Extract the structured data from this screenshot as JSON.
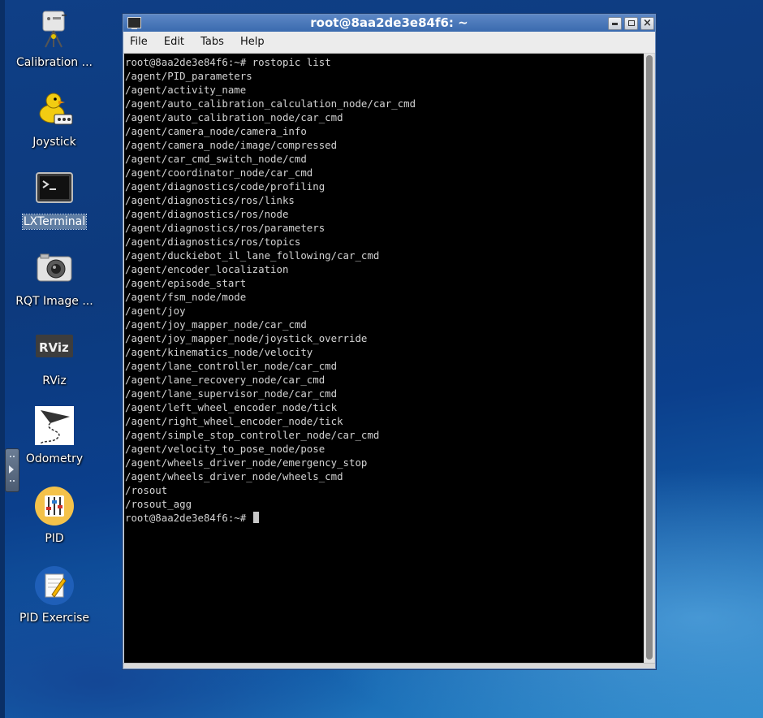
{
  "desktop": {
    "icons": [
      {
        "label": "Calibration ...",
        "icon": "calibration-icon"
      },
      {
        "label": "Joystick",
        "icon": "duck-joystick-icon"
      },
      {
        "label": "LXTerminal",
        "icon": "terminal-icon",
        "selected": true
      },
      {
        "label": "RQT Image ...",
        "icon": "camera-icon"
      },
      {
        "label": "RViz",
        "icon": "rviz-icon"
      },
      {
        "label": "Odometry",
        "icon": "paper-plane-path-icon"
      },
      {
        "label": "PID",
        "icon": "pid-sliders-icon"
      },
      {
        "label": "PID Exercise",
        "icon": "pid-exercise-icon"
      }
    ]
  },
  "window": {
    "title": "root@8aa2de3e84f6: ~",
    "buttons": {
      "minimize": "▫",
      "maximize": "▫",
      "close": "×"
    },
    "menu": [
      "File",
      "Edit",
      "Tabs",
      "Help"
    ]
  },
  "terminal": {
    "prompt": "root@8aa2de3e84f6:~#",
    "command": "rostopic list",
    "output": [
      "/agent/PID_parameters",
      "/agent/activity_name",
      "/agent/auto_calibration_calculation_node/car_cmd",
      "/agent/auto_calibration_node/car_cmd",
      "/agent/camera_node/camera_info",
      "/agent/camera_node/image/compressed",
      "/agent/car_cmd_switch_node/cmd",
      "/agent/coordinator_node/car_cmd",
      "/agent/diagnostics/code/profiling",
      "/agent/diagnostics/ros/links",
      "/agent/diagnostics/ros/node",
      "/agent/diagnostics/ros/parameters",
      "/agent/diagnostics/ros/topics",
      "/agent/duckiebot_il_lane_following/car_cmd",
      "/agent/encoder_localization",
      "/agent/episode_start",
      "/agent/fsm_node/mode",
      "/agent/joy",
      "/agent/joy_mapper_node/car_cmd",
      "/agent/joy_mapper_node/joystick_override",
      "/agent/kinematics_node/velocity",
      "/agent/lane_controller_node/car_cmd",
      "/agent/lane_recovery_node/car_cmd",
      "/agent/lane_supervisor_node/car_cmd",
      "/agent/left_wheel_encoder_node/tick",
      "/agent/right_wheel_encoder_node/tick",
      "/agent/simple_stop_controller_node/car_cmd",
      "/agent/velocity_to_pose_node/pose",
      "/agent/wheels_driver_node/emergency_stop",
      "/agent/wheels_driver_node/wheels_cmd",
      "/rosout",
      "/rosout_agg"
    ]
  },
  "colors": {
    "terminal_bg": "#000000",
    "terminal_fg": "#d3d3d3",
    "titlebar": "#4a79bb",
    "desktop": "#0d3a7d"
  }
}
